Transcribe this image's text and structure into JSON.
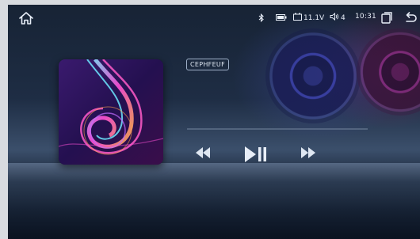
{
  "status": {
    "voltage": "11.1V",
    "volume": "4",
    "time": "10:31"
  },
  "player": {
    "track_label": "CEPHFEUF",
    "progress": 0
  },
  "icons": {
    "home": "home-icon",
    "bluetooth": "bluetooth-icon",
    "battery": "battery-icon",
    "car_battery": "car-battery-icon",
    "volume": "speaker-icon",
    "recent_apps": "recent-apps-icon",
    "back": "back-icon",
    "previous": "previous-icon",
    "play_pause": "play-pause-icon",
    "next": "next-icon"
  },
  "colors": {
    "accent": "#e8eef8",
    "background_top": "#172335",
    "background_bottom": "#0f1a2b"
  }
}
